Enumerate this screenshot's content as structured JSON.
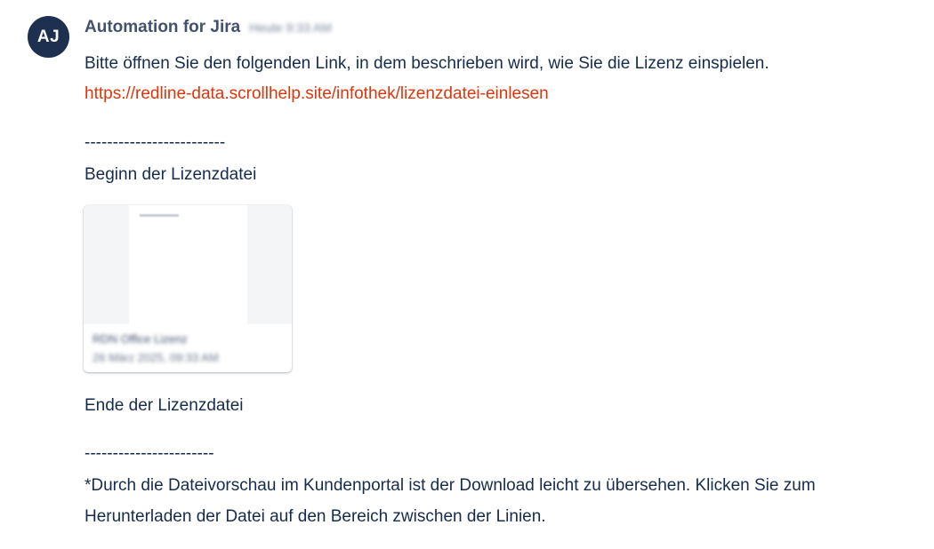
{
  "comment": {
    "avatar_initials": "AJ",
    "author": "Automation for Jira",
    "timestamp": "Heute 9:33 AM",
    "lines": {
      "intro": "Bitte öffnen Sie den folgenden Link, in dem beschrieben wird, wie Sie die Lizenz einspielen.",
      "link": "https://redline-data.scrollhelp.site/infothek/lizenzdatei-einlesen",
      "divider_top": "-------------------------",
      "begin_label": "Beginn der Lizenzdatei",
      "end_label": "Ende der Lizenzdatei",
      "divider_bottom": "-----------------------",
      "note_line1": "*Durch die Dateivorschau im Kundenportal ist der Download leicht zu übersehen. Klicken Sie zum",
      "note_line2": "Herunterladen der Datei auf den Bereich zwischen der Linien."
    },
    "attachment": {
      "file_name": "RDN Office Lizenz",
      "file_date": "26 März 2025, 09:33 AM"
    }
  },
  "colors": {
    "avatar_bg": "#1d3050",
    "author_text": "#42526e",
    "body_text": "#172b4d",
    "link": "#de350b"
  }
}
